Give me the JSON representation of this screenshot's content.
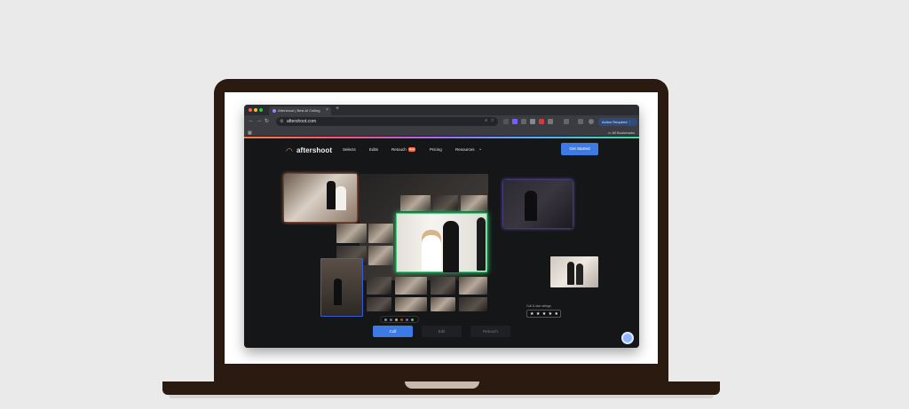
{
  "browser": {
    "tab_title": "Aftershoot | Best AI Culling",
    "tab_close": "×",
    "new_tab": "+",
    "url": "aftershoot.com",
    "active_button": "Action Required ⋮",
    "bookmarks_all": "All Bookmarks"
  },
  "site": {
    "logo": "aftershoot",
    "nav": [
      "Selects",
      "Edits",
      "Retouch",
      "Pricing",
      "Resources"
    ],
    "new_badge": "New",
    "cta": "Get Started",
    "rating_label": "Cull & star ratings",
    "rating_stars": "★ ★ ★ ★ ★",
    "bottom_tabs": [
      "Cull",
      "Edit",
      "Retouch"
    ]
  },
  "colors": {
    "accent": "#3c7be6",
    "brand_orange": "#f29a4a"
  }
}
